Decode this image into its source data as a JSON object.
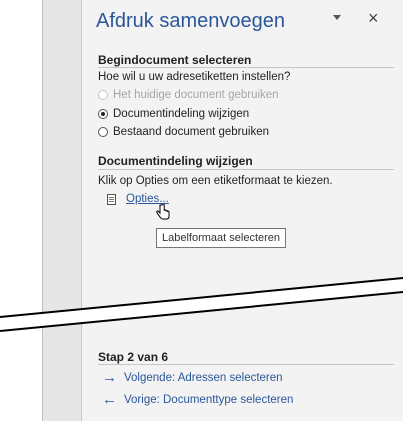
{
  "pane": {
    "title": "Afdruk samenvoegen",
    "close_glyph": "×"
  },
  "section1": {
    "heading": "Begindocument selecteren",
    "question": "Hoe wil u uw adresetiketten instellen?",
    "options": [
      {
        "label": "Het huidige document gebruiken",
        "selected": false,
        "disabled": true
      },
      {
        "label": "Documentindeling wijzigen",
        "selected": true,
        "disabled": false
      },
      {
        "label": "Bestaand document gebruiken",
        "selected": false,
        "disabled": false
      }
    ]
  },
  "section2": {
    "heading": "Documentindeling wijzigen",
    "instruction": "Klik op Opties om een etiketformaat te kiezen.",
    "options_link": "Opties...",
    "tooltip": "Labelformaat selecteren"
  },
  "footer": {
    "step": "Stap 2 van 6",
    "next_arrow": "→",
    "next_label": "Volgende: Adressen selecteren",
    "prev_arrow": "←",
    "prev_label": "Vorige: Documenttype selecteren"
  },
  "colors": {
    "accent": "#2b579a",
    "pane_background": "#f3f3f3"
  },
  "icons": {
    "dropdown": "chevron-down-icon",
    "close": "close-icon",
    "options": "document-icon",
    "cursor": "hand-pointer-icon",
    "next": "arrow-right-icon",
    "prev": "arrow-left-icon"
  }
}
